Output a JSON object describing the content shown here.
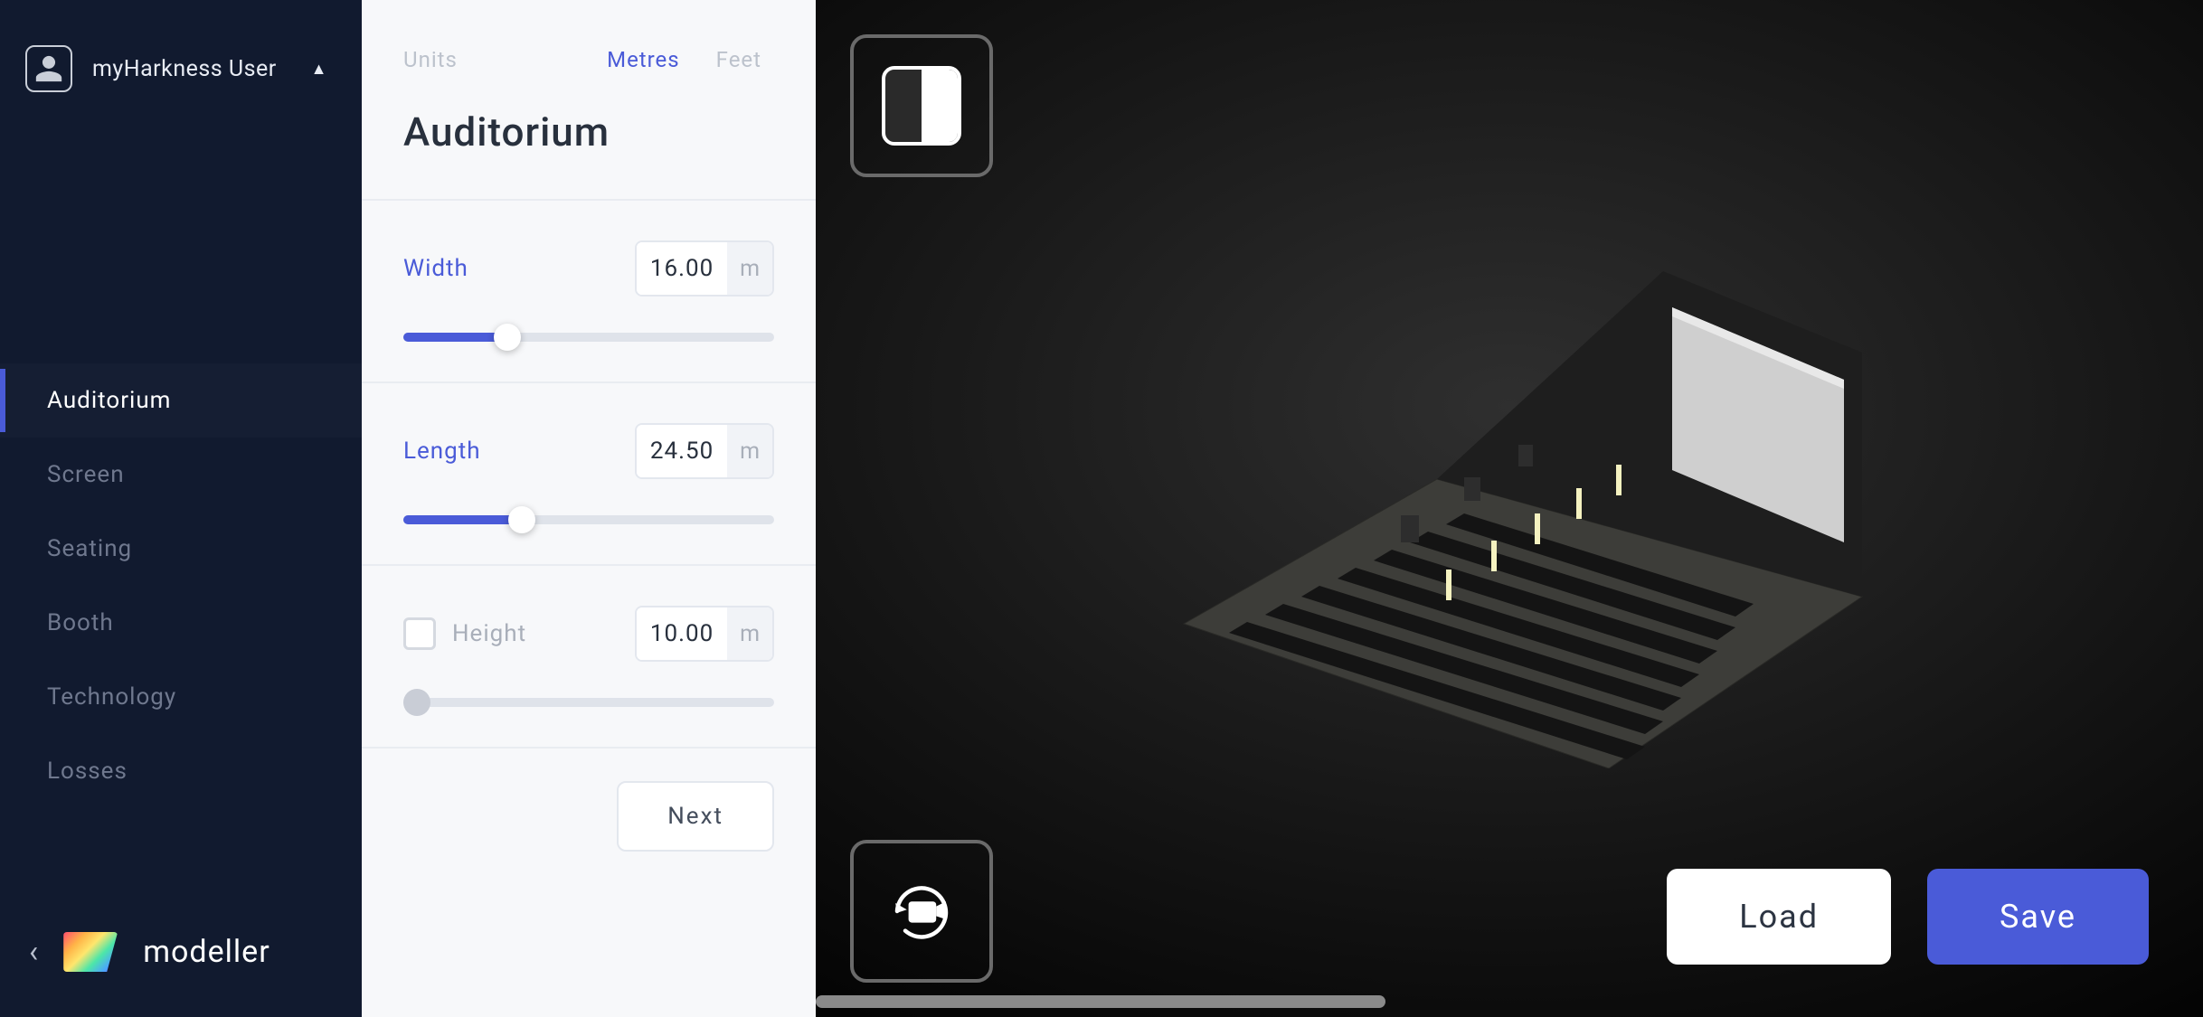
{
  "user": {
    "name": "myHarkness User"
  },
  "brand": {
    "name": "modeller"
  },
  "nav": {
    "items": [
      {
        "label": "Auditorium",
        "active": true
      },
      {
        "label": "Screen",
        "active": false
      },
      {
        "label": "Seating",
        "active": false
      },
      {
        "label": "Booth",
        "active": false
      },
      {
        "label": "Technology",
        "active": false
      },
      {
        "label": "Losses",
        "active": false
      }
    ]
  },
  "panel": {
    "units_label": "Units",
    "unit_metres": "Metres",
    "unit_feet": "Feet",
    "unit_selected": "Metres",
    "title": "Auditorium",
    "unit_suffix": "m",
    "params": [
      {
        "label": "Width",
        "value": "16.00",
        "active": true,
        "percent": 28,
        "checkbox": false
      },
      {
        "label": "Length",
        "value": "24.50",
        "active": true,
        "percent": 32,
        "checkbox": false
      },
      {
        "label": "Height",
        "value": "10.00",
        "active": false,
        "percent": 0,
        "checkbox": true
      }
    ],
    "next_label": "Next"
  },
  "viewport": {
    "load_label": "Load",
    "save_label": "Save"
  },
  "colors": {
    "accent": "#4a5bd8",
    "nav_bg": "#111a2f",
    "panel_bg": "#f7f8fa"
  }
}
